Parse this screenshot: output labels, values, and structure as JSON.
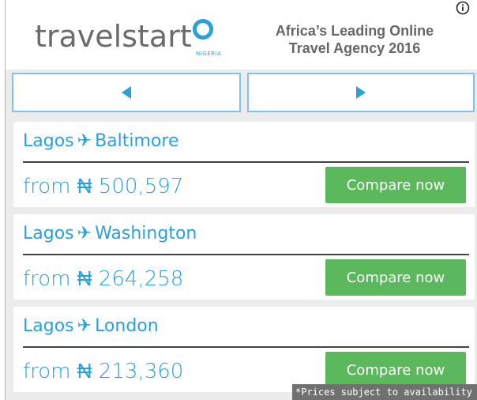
{
  "header": {
    "logo_text": "travelstart",
    "logo_sub": "NIGERIA",
    "tagline_line1": "Africa’s Leading Online",
    "tagline_line2": "Travel Agency 2016",
    "info_icon": "info-icon"
  },
  "nav": {
    "prev_icon": "triangle-left-icon",
    "next_icon": "triangle-right-icon"
  },
  "colors": {
    "brand_blue": "#2aa0dd",
    "cta_green": "#5cb85c",
    "logo_grey": "#6b6b6b",
    "nav_border": "#7fc3e8"
  },
  "offers": [
    {
      "origin": "Lagos",
      "plane": "✈",
      "destination": "Baltimore",
      "price": "from ₦ 500,597",
      "cta": "Compare now"
    },
    {
      "origin": "Lagos",
      "plane": "✈",
      "destination": "Washington",
      "price": "from ₦ 264,258",
      "cta": "Compare now"
    },
    {
      "origin": "Lagos",
      "plane": "✈",
      "destination": "London",
      "price": "from ₦ 213,360",
      "cta": "Compare now"
    }
  ],
  "disclaimer": "*Prices subject to availability"
}
